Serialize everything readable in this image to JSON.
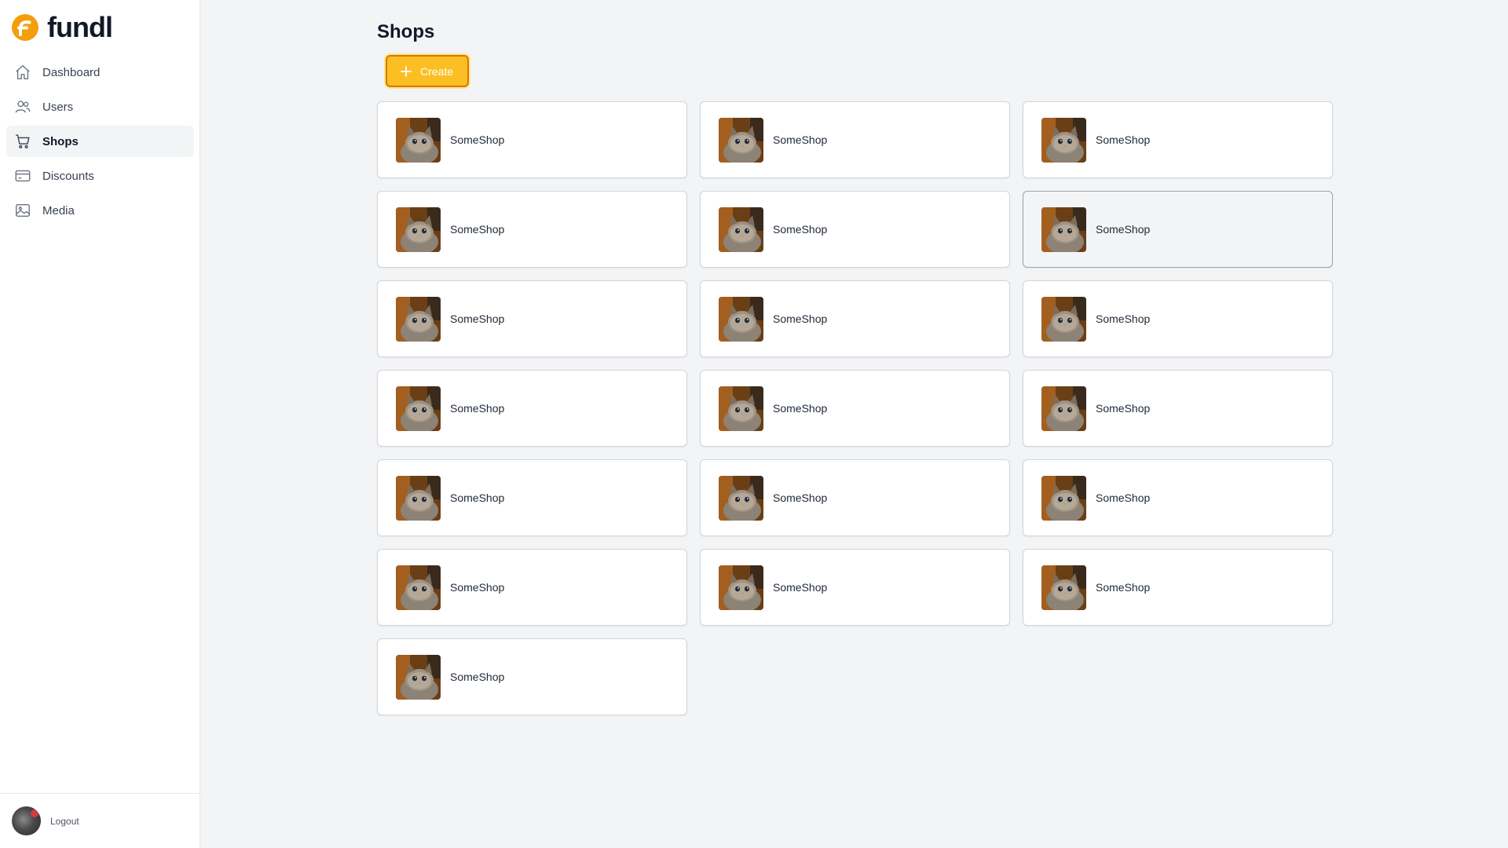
{
  "brand": {
    "name": "fundl",
    "accent": "#f59e0b"
  },
  "nav": {
    "items": [
      {
        "label": "Dashboard",
        "icon": "home-icon",
        "active": false
      },
      {
        "label": "Users",
        "icon": "users-icon",
        "active": false
      },
      {
        "label": "Shops",
        "icon": "cart-icon",
        "active": true
      },
      {
        "label": "Discounts",
        "icon": "credit-card-icon",
        "active": false
      },
      {
        "label": "Media",
        "icon": "image-icon",
        "active": false
      }
    ]
  },
  "footer": {
    "logout_label": "Logout",
    "avatar_icon": "user-avatar"
  },
  "page": {
    "title": "Shops",
    "create_label": "Create",
    "create_icon": "plus-icon"
  },
  "shops": [
    {
      "name": "SomeShop"
    },
    {
      "name": "SomeShop"
    },
    {
      "name": "SomeShop"
    },
    {
      "name": "SomeShop"
    },
    {
      "name": "SomeShop"
    },
    {
      "name": "SomeShop",
      "hovered": true
    },
    {
      "name": "SomeShop"
    },
    {
      "name": "SomeShop"
    },
    {
      "name": "SomeShop"
    },
    {
      "name": "SomeShop"
    },
    {
      "name": "SomeShop"
    },
    {
      "name": "SomeShop"
    },
    {
      "name": "SomeShop"
    },
    {
      "name": "SomeShop"
    },
    {
      "name": "SomeShop"
    },
    {
      "name": "SomeShop"
    },
    {
      "name": "SomeShop"
    },
    {
      "name": "SomeShop"
    },
    {
      "name": "SomeShop"
    }
  ],
  "colors": {
    "primary_button": "#fbbf24",
    "background": "#f3f4f6",
    "sidebar": "#ffffff"
  }
}
